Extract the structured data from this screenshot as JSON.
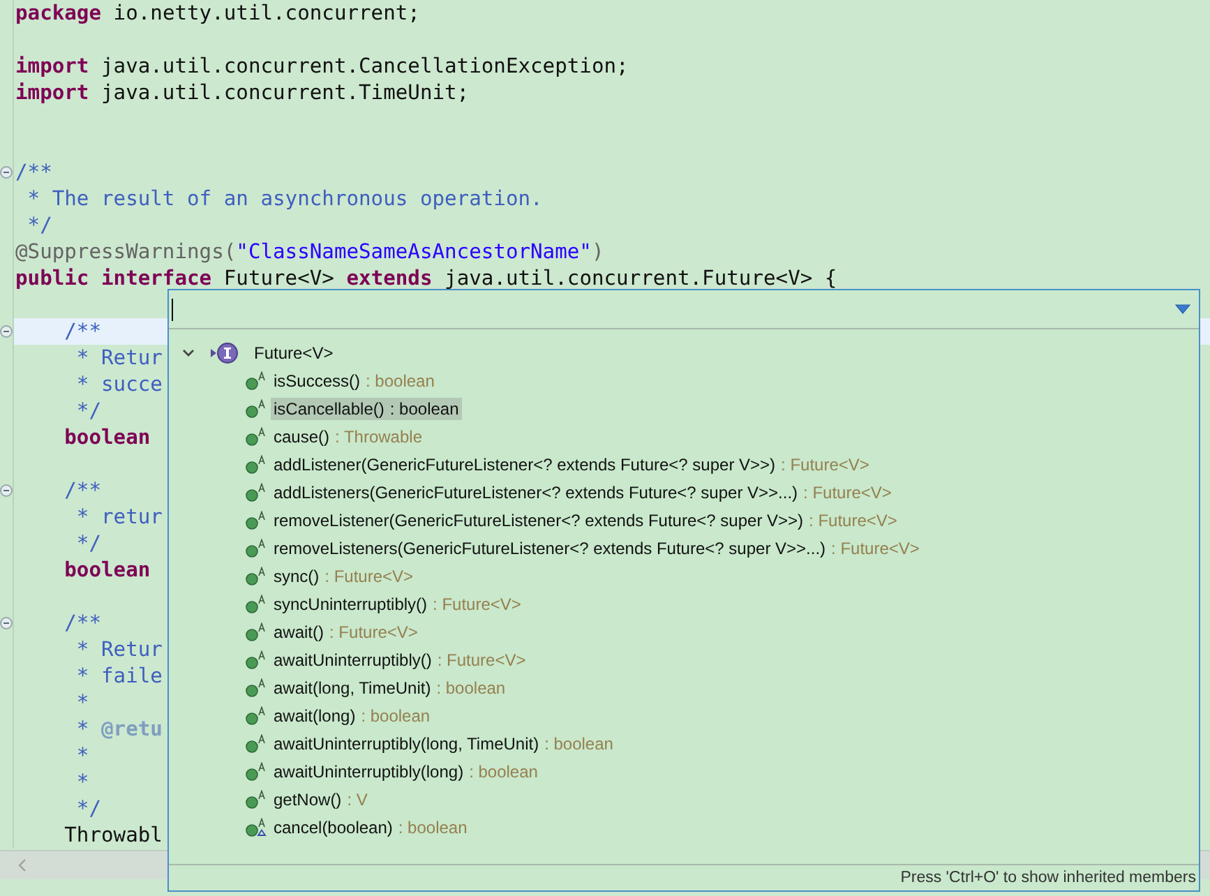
{
  "editor": {
    "lines": [
      {
        "kind": "code",
        "segments": [
          {
            "kind": "keyword",
            "text": "package"
          },
          {
            "kind": "plain",
            "text": " io.netty.util.concurrent;"
          }
        ]
      },
      {
        "kind": "blank"
      },
      {
        "kind": "code",
        "segments": [
          {
            "kind": "keyword",
            "text": "import"
          },
          {
            "kind": "plain",
            "text": " java.util.concurrent.CancellationException;"
          }
        ]
      },
      {
        "kind": "code",
        "segments": [
          {
            "kind": "keyword",
            "text": "import"
          },
          {
            "kind": "plain",
            "text": " java.util.concurrent.TimeUnit;"
          }
        ]
      },
      {
        "kind": "blank"
      },
      {
        "kind": "blank"
      },
      {
        "kind": "code",
        "fold_marker": true,
        "segments": [
          {
            "kind": "javadoc",
            "text": "/**"
          }
        ]
      },
      {
        "kind": "code",
        "segments": [
          {
            "kind": "javadoc",
            "text": " * The result of an asynchronous operation."
          }
        ]
      },
      {
        "kind": "code",
        "segments": [
          {
            "kind": "javadoc",
            "text": " */"
          }
        ]
      },
      {
        "kind": "code",
        "segments": [
          {
            "kind": "annotation",
            "text": "@SuppressWarnings("
          },
          {
            "kind": "string",
            "text": "\"ClassNameSameAsAncestorName\""
          },
          {
            "kind": "annotation",
            "text": ")"
          }
        ]
      },
      {
        "kind": "code",
        "segments": [
          {
            "kind": "keyword",
            "text": "public"
          },
          {
            "kind": "keyword",
            "text": " interface"
          },
          {
            "kind": "plain",
            "text": " Future<V> "
          },
          {
            "kind": "keyword",
            "text": "extends"
          },
          {
            "kind": "plain",
            "text": " java.util.concurrent.Future<V> {"
          }
        ]
      },
      {
        "kind": "blank"
      },
      {
        "kind": "code",
        "fold_marker": true,
        "current": true,
        "segments": [
          {
            "kind": "javadoc",
            "text": "    /**"
          }
        ]
      },
      {
        "kind": "code",
        "segments": [
          {
            "kind": "javadoc",
            "text": "     * Retur"
          }
        ]
      },
      {
        "kind": "code",
        "segments": [
          {
            "kind": "javadoc",
            "text": "     * succe"
          }
        ]
      },
      {
        "kind": "code",
        "segments": [
          {
            "kind": "javadoc",
            "text": "     */"
          }
        ]
      },
      {
        "kind": "code",
        "segments": [
          {
            "kind": "keyword",
            "text": "    boolean"
          }
        ]
      },
      {
        "kind": "blank"
      },
      {
        "kind": "code",
        "fold_marker": true,
        "segments": [
          {
            "kind": "javadoc",
            "text": "    /**"
          }
        ]
      },
      {
        "kind": "code",
        "segments": [
          {
            "kind": "javadoc",
            "text": "     * retur"
          }
        ]
      },
      {
        "kind": "code",
        "segments": [
          {
            "kind": "javadoc",
            "text": "     */"
          }
        ]
      },
      {
        "kind": "code",
        "segments": [
          {
            "kind": "keyword",
            "text": "    boolean"
          }
        ]
      },
      {
        "kind": "blank"
      },
      {
        "kind": "code",
        "fold_marker": true,
        "segments": [
          {
            "kind": "javadoc",
            "text": "    /**"
          }
        ]
      },
      {
        "kind": "code",
        "segments": [
          {
            "kind": "javadoc",
            "text": "     * Retur"
          }
        ]
      },
      {
        "kind": "code",
        "segments": [
          {
            "kind": "javadoc",
            "text": "     * faile"
          }
        ]
      },
      {
        "kind": "code",
        "segments": [
          {
            "kind": "javadoc",
            "text": "     *"
          }
        ]
      },
      {
        "kind": "code",
        "segments": [
          {
            "kind": "javadoc",
            "text": "     * "
          },
          {
            "kind": "javadoc_tag",
            "text": "@retu"
          }
        ]
      },
      {
        "kind": "code",
        "segments": [
          {
            "kind": "javadoc",
            "text": "     *"
          }
        ]
      },
      {
        "kind": "code",
        "segments": [
          {
            "kind": "javadoc",
            "text": "     *"
          }
        ]
      },
      {
        "kind": "code",
        "segments": [
          {
            "kind": "javadoc",
            "text": "     */"
          }
        ]
      },
      {
        "kind": "code",
        "segments": [
          {
            "kind": "plain",
            "text": "    Throwabl"
          }
        ]
      }
    ]
  },
  "outline_popup": {
    "root": {
      "label": "Future<V>",
      "expanded": true,
      "children": [
        {
          "name": "isSuccess()",
          "type": ": boolean",
          "selected": false,
          "overrides": false
        },
        {
          "name": "isCancellable()",
          "type": ": boolean",
          "selected": true,
          "overrides": false
        },
        {
          "name": "cause()",
          "type": ": Throwable",
          "selected": false,
          "overrides": false
        },
        {
          "name": "addListener(GenericFutureListener<? extends Future<? super V>>)",
          "type": ": Future<V>",
          "selected": false,
          "overrides": false
        },
        {
          "name": "addListeners(GenericFutureListener<? extends Future<? super V>>...)",
          "type": ": Future<V>",
          "selected": false,
          "overrides": false
        },
        {
          "name": "removeListener(GenericFutureListener<? extends Future<? super V>>)",
          "type": ": Future<V>",
          "selected": false,
          "overrides": false
        },
        {
          "name": "removeListeners(GenericFutureListener<? extends Future<? super V>>...)",
          "type": ": Future<V>",
          "selected": false,
          "overrides": false
        },
        {
          "name": "sync()",
          "type": ": Future<V>",
          "selected": false,
          "overrides": false
        },
        {
          "name": "syncUninterruptibly()",
          "type": ": Future<V>",
          "selected": false,
          "overrides": false
        },
        {
          "name": "await()",
          "type": ": Future<V>",
          "selected": false,
          "overrides": false
        },
        {
          "name": "awaitUninterruptibly()",
          "type": ": Future<V>",
          "selected": false,
          "overrides": false
        },
        {
          "name": "await(long, TimeUnit)",
          "type": ": boolean",
          "selected": false,
          "overrides": false
        },
        {
          "name": "await(long)",
          "type": ": boolean",
          "selected": false,
          "overrides": false
        },
        {
          "name": "awaitUninterruptibly(long, TimeUnit)",
          "type": ": boolean",
          "selected": false,
          "overrides": false
        },
        {
          "name": "awaitUninterruptibly(long)",
          "type": ": boolean",
          "selected": false,
          "overrides": false
        },
        {
          "name": "getNow()",
          "type": ": V",
          "selected": false,
          "overrides": false
        },
        {
          "name": "cancel(boolean)",
          "type": ": boolean",
          "selected": false,
          "overrides": true
        }
      ]
    },
    "status": "Press 'Ctrl+O' to show inherited members"
  }
}
